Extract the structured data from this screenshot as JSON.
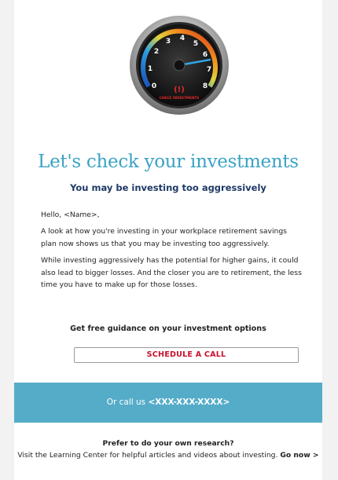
{
  "hero": {
    "gauge_numbers": [
      "0",
      "1",
      "2",
      "3",
      "4",
      "5",
      "6",
      "7",
      "8"
    ],
    "gauge_label_top": "(!)",
    "gauge_label_bottom": "CHECK INVESTMENTS"
  },
  "headline": "Let's check your investments",
  "subhead": "You may be investing too aggressively",
  "body": {
    "greeting": "Hello, <Name>,",
    "para1": "A look at how you're investing in your workplace retirement savings plan now shows us that you may be investing too aggressively.",
    "para2": "While investing aggressively has the potential for higher gains, it could also lead to bigger losses. And the closer you are to retirement, the less time you have to make up for those losses."
  },
  "guidance": "Get free guidance on your investment options",
  "cta_label": "SCHEDULE A CALL",
  "callbar": {
    "prefix": "Or call us ",
    "phone": "<XXX-XXX-XXXX>"
  },
  "research": {
    "question": "Prefer to do your own research?",
    "text": "Visit the Learning Center for helpful articles and videos about investing.",
    "link": "Go now >"
  },
  "colors": {
    "headline": "#3aa3c4",
    "subhead": "#1f3a66",
    "cta_text": "#c8102e",
    "callbar_bg": "#55acc9"
  }
}
